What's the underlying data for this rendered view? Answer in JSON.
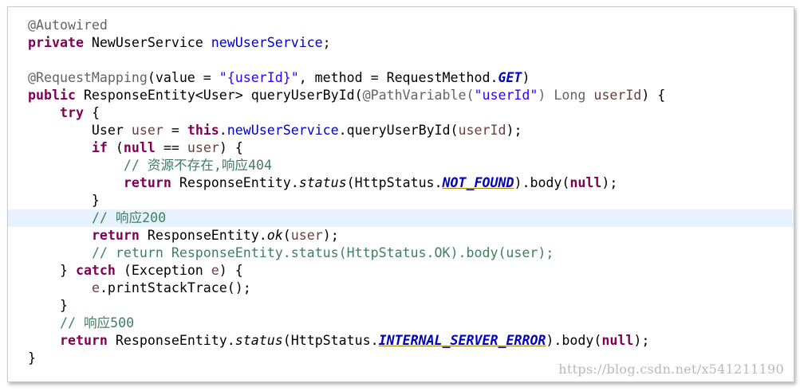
{
  "code": {
    "l1": {
      "a": "@Autowired"
    },
    "l2": {
      "a": "private",
      "b": " NewUserService ",
      "c": "newUserService",
      "d": ";"
    },
    "l4": {
      "a": "@RequestMapping",
      "b": "(value = ",
      "c": "\"{userId}\"",
      "d": ", method = RequestMethod.",
      "e": "GET",
      "f": ")"
    },
    "l5": {
      "a": "public",
      "b": " ResponseEntity<User> queryUserById(",
      "c": "@PathVariable",
      "d": "(",
      "e": "\"userId\"",
      "f": ") Long ",
      "g": "userId",
      "h": ") {"
    },
    "l6": {
      "a": "    ",
      "b": "try",
      "c": " {"
    },
    "l7": {
      "a": "        User ",
      "b": "user",
      "c": " = ",
      "d": "this",
      "e": ".",
      "f": "newUserService",
      "g": ".queryUserById(",
      "h": "userId",
      "i": ");"
    },
    "l8": {
      "a": "        ",
      "b": "if",
      "c": " (",
      "d": "null",
      "e": " == ",
      "f": "user",
      "g": ") {"
    },
    "l9": {
      "a": "            ",
      "b": "// 资源不存在,响应404"
    },
    "l10": {
      "a": "            ",
      "b": "return",
      "c": " ResponseEntity.",
      "d": "status",
      "e": "(HttpStatus.",
      "f": "NOT_FOUND",
      "g": ").body(",
      "h": "null",
      "i": ");"
    },
    "l11": {
      "a": "        }"
    },
    "l12": {
      "a": "        ",
      "b": "// 响应200"
    },
    "l13": {
      "a": "        ",
      "b": "return",
      "c": " ResponseEntity.",
      "d": "ok",
      "e": "(",
      "f": "user",
      "g": ");"
    },
    "l14": {
      "a": "        ",
      "b": "// return ResponseEntity.status(HttpStatus.OK).body(user);"
    },
    "l15": {
      "a": "    } ",
      "b": "catch",
      "c": " (Exception ",
      "d": "e",
      "e": ") {"
    },
    "l16": {
      "a": "        ",
      "b": "e",
      "c": ".printStackTrace();"
    },
    "l17": {
      "a": "    }"
    },
    "l18": {
      "a": "    ",
      "b": "// 响应500"
    },
    "l19": {
      "a": "    ",
      "b": "return",
      "c": " ResponseEntity.",
      "d": "status",
      "e": "(HttpStatus.",
      "f": "INTERNAL_SERVER_ERROR",
      "g": ").body(",
      "h": "null",
      "i": ");"
    },
    "l20": {
      "a": "}"
    }
  },
  "watermark": "https://blog.csdn.net/x541211190"
}
